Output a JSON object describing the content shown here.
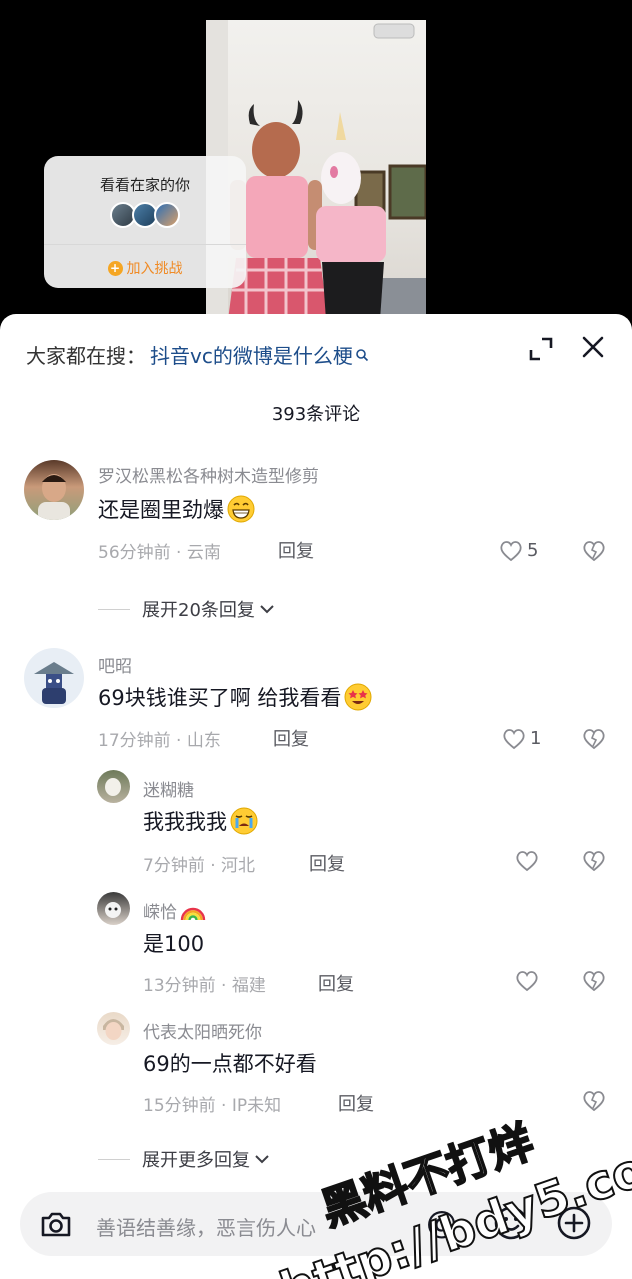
{
  "challenge": {
    "title": "看看在家的你",
    "join_label": "加入挑战"
  },
  "search": {
    "prefix": "大家都在搜：",
    "query": "抖音vc的微博是什么梗"
  },
  "comment_count": "393条评论",
  "comments": [
    {
      "username": "罗汉松黑松各种树木造型修剪",
      "text": "还是圈里劲爆",
      "emoji": "grinning-face",
      "meta": "56分钟前 · 云南",
      "reply": "回复",
      "likes": "5",
      "expand": "展开20条回复"
    },
    {
      "username": "吧昭",
      "text": "69块钱谁买了啊 给我看看",
      "emoji": "star-struck-face",
      "meta": "17分钟前 · 山东",
      "reply": "回复",
      "likes": "1",
      "replies": [
        {
          "username": "迷糊糖",
          "text": "我我我我",
          "emoji": "crying-face",
          "meta": "7分钟前 · 河北",
          "reply": "回复"
        },
        {
          "username": "嵘恰",
          "user_emoji": "rainbow",
          "text": "是100",
          "meta": "13分钟前 · 福建",
          "reply": "回复"
        },
        {
          "username": "代表太阳晒死你",
          "text": "69的一点都不好看",
          "meta": "15分钟前 · IP未知",
          "reply": "回复"
        }
      ],
      "expand": "展开更多回复"
    }
  ],
  "input": {
    "placeholder": "善语结善缘，恶言伤人心"
  },
  "watermark": {
    "line1": "黑料不打烊",
    "line2": "http://bdy5.co"
  },
  "colors": {
    "link_blue": "#1d4d8a",
    "challenge_orange": "#f08a24",
    "text_dark": "#161823",
    "text_gray": "#8a8b91"
  }
}
